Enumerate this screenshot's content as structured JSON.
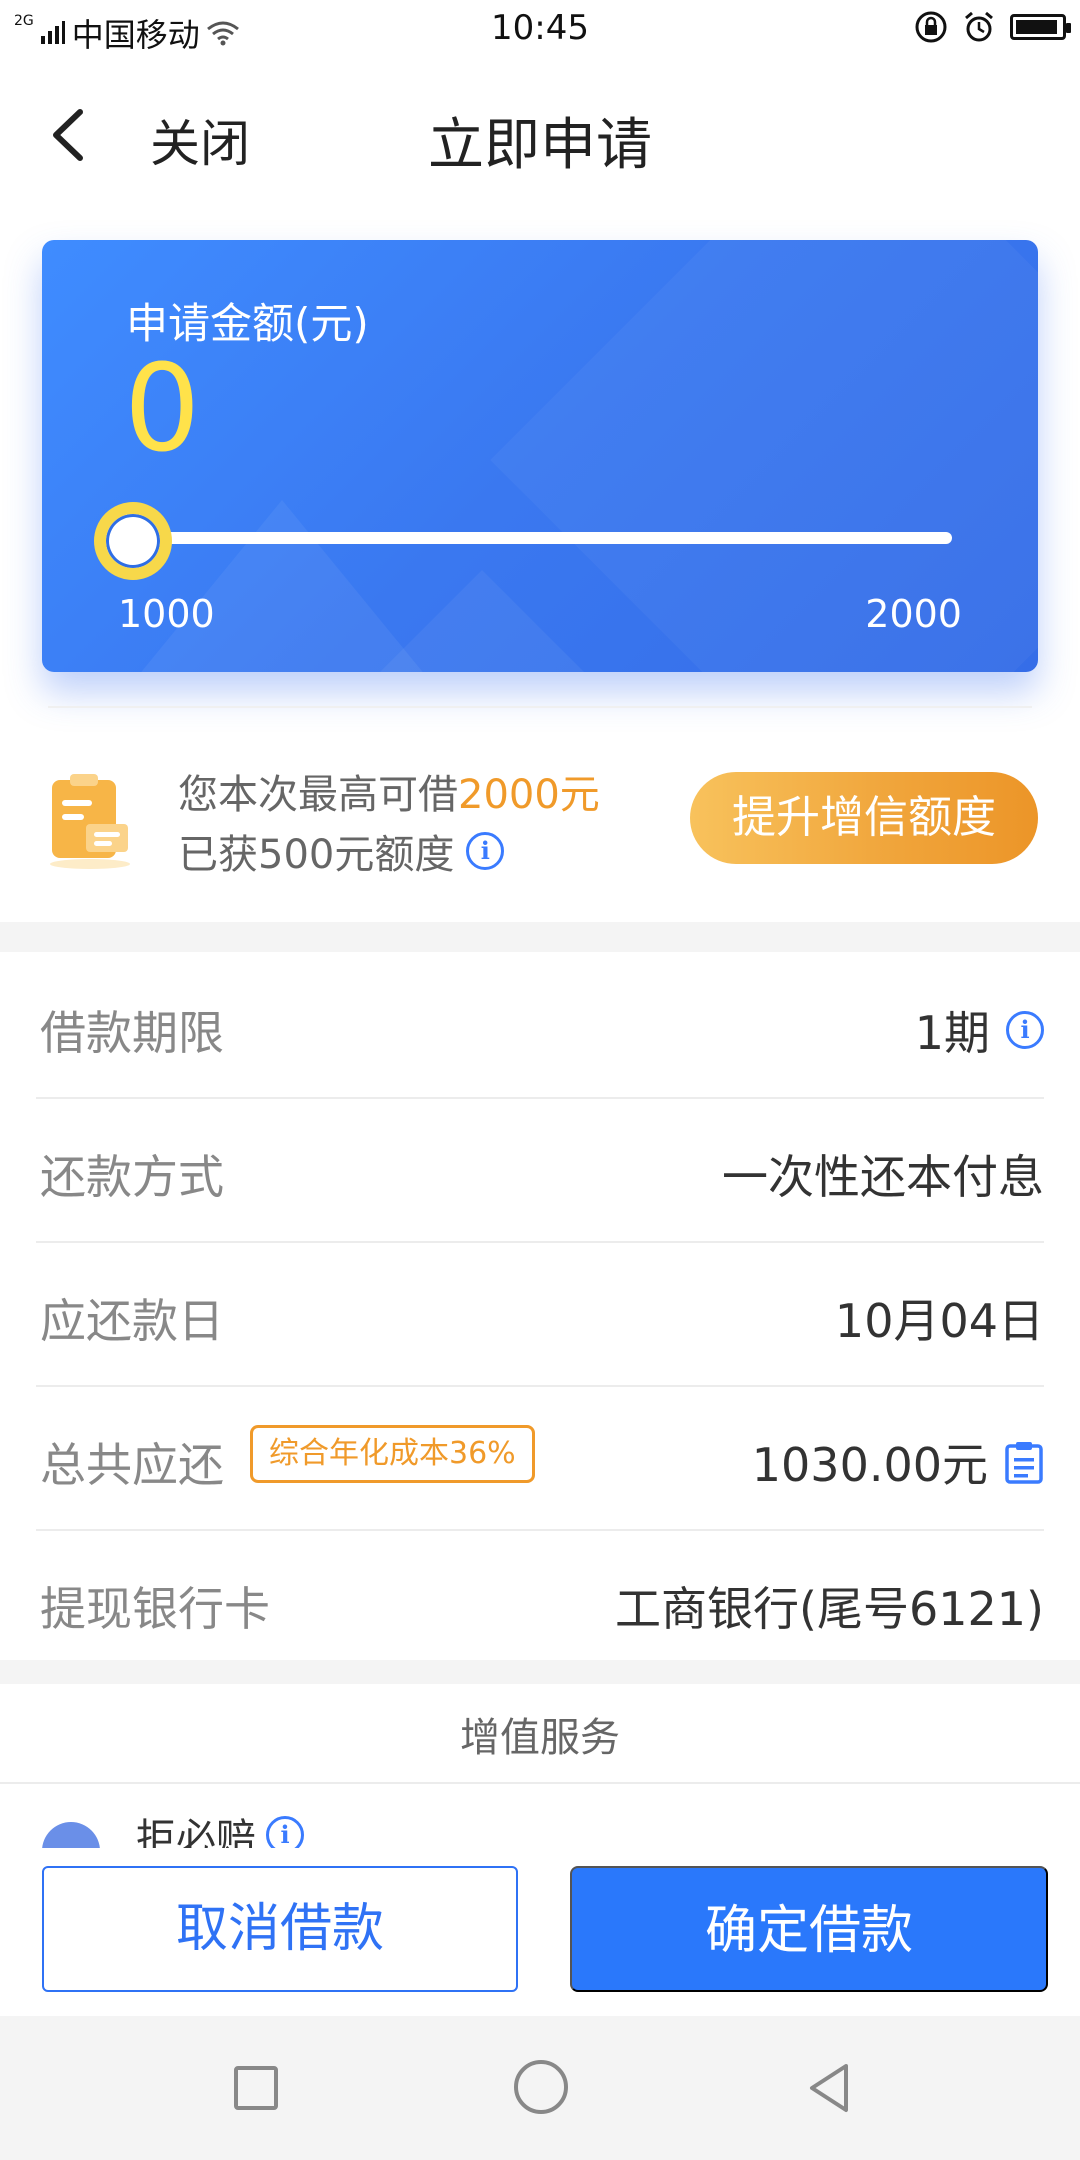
{
  "status_bar": {
    "network_small": "2G",
    "carrier": "中国移动",
    "time": "10:45"
  },
  "header": {
    "close_label": "关闭",
    "title": "立即申请"
  },
  "amount_card": {
    "label": "申请金额(元)",
    "amount": "0",
    "slider_min": "1000",
    "slider_max": "2000",
    "slider_level": 0
  },
  "limit": {
    "line1_prefix": "您本次最高可借",
    "line1_highlight": "2000元",
    "line2": "已获500元额度",
    "boost_button": "提升增信额度"
  },
  "details": [
    {
      "label": "借款期限",
      "value": "1期"
    },
    {
      "label": "还款方式",
      "value": "一次性还本付息"
    },
    {
      "label": "应还款日",
      "value": "10月04日"
    },
    {
      "label": "总共应还",
      "badge": "综合年化成本36%",
      "value": "1030.00元"
    },
    {
      "label": "提现银行卡",
      "value": "工商银行(尾号6121)"
    }
  ],
  "value_added": {
    "title": "增值服务",
    "item_name": "拒必赔"
  },
  "actions": {
    "cancel": "取消借款",
    "confirm": "确定借款"
  },
  "colors": {
    "accent_blue": "#2a78fb",
    "highlight_orange": "#f09a2a",
    "amount_yellow": "#ffe24a"
  }
}
